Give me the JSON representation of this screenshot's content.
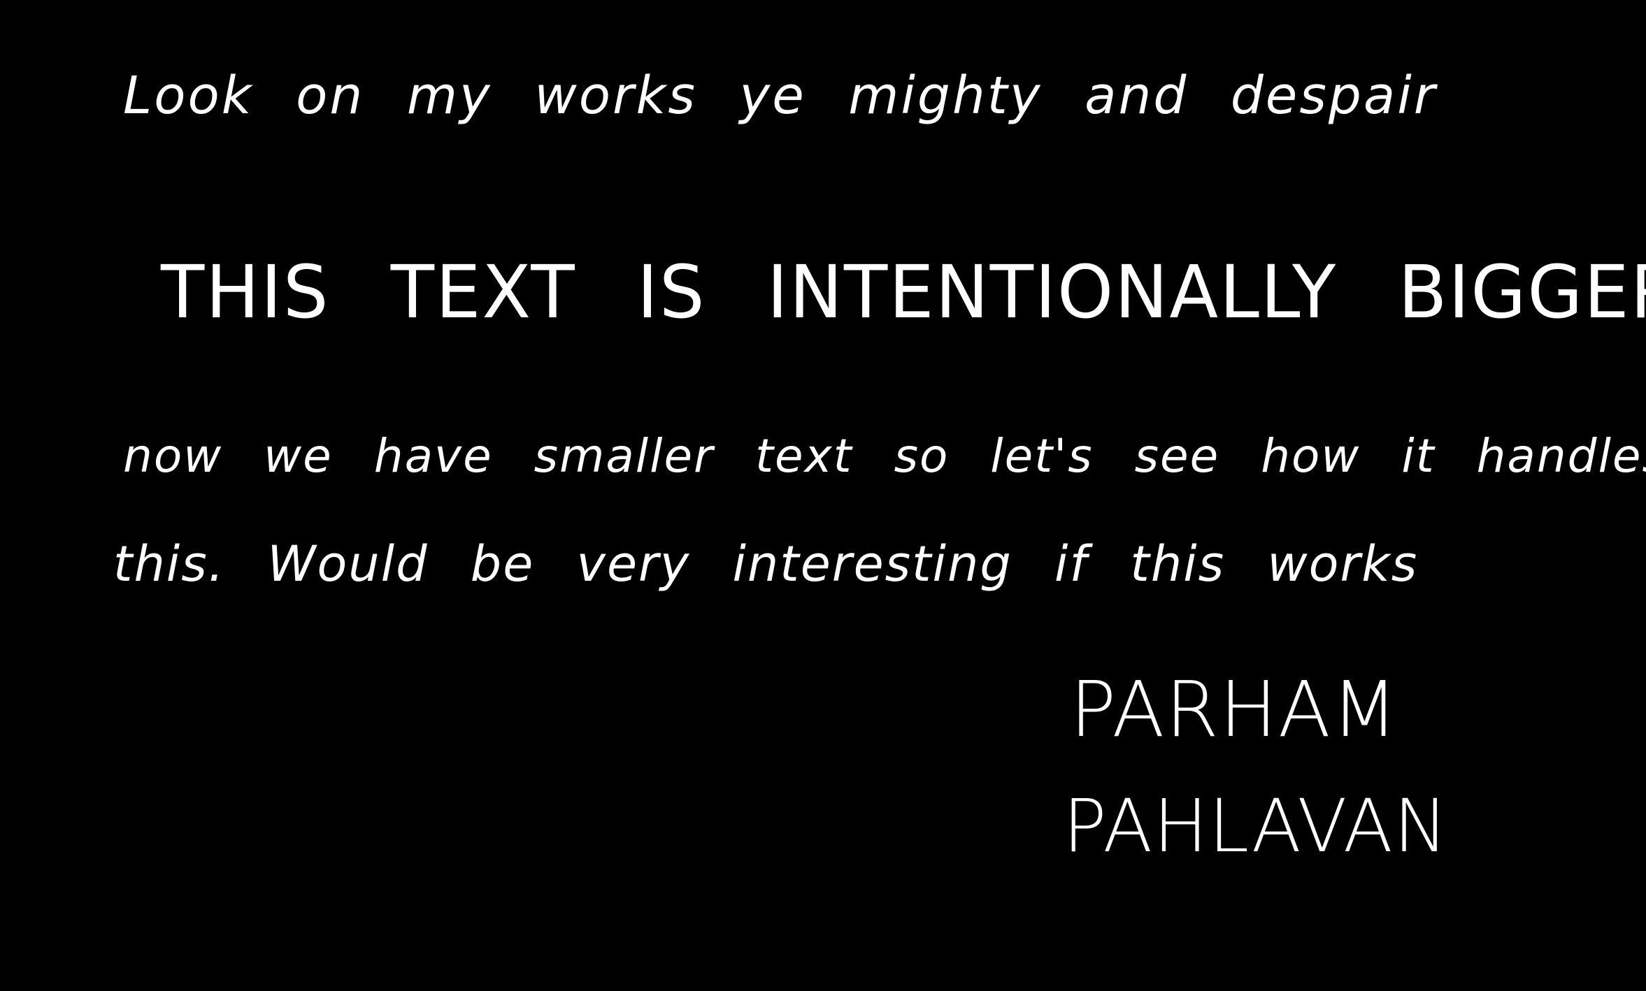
{
  "note": {
    "lines": [
      "Look on my works ye mighty and despair",
      "THIS TEXT IS INTENTIONALLY BIGGER",
      "now we have smaller text so let's see how it handles",
      "this. Would be very interesting if this works"
    ],
    "signature": {
      "first_name": "PARHAM",
      "last_name": "PAHLAVAN"
    }
  },
  "colors": {
    "background": "#000000",
    "ink": "#ffffff"
  }
}
